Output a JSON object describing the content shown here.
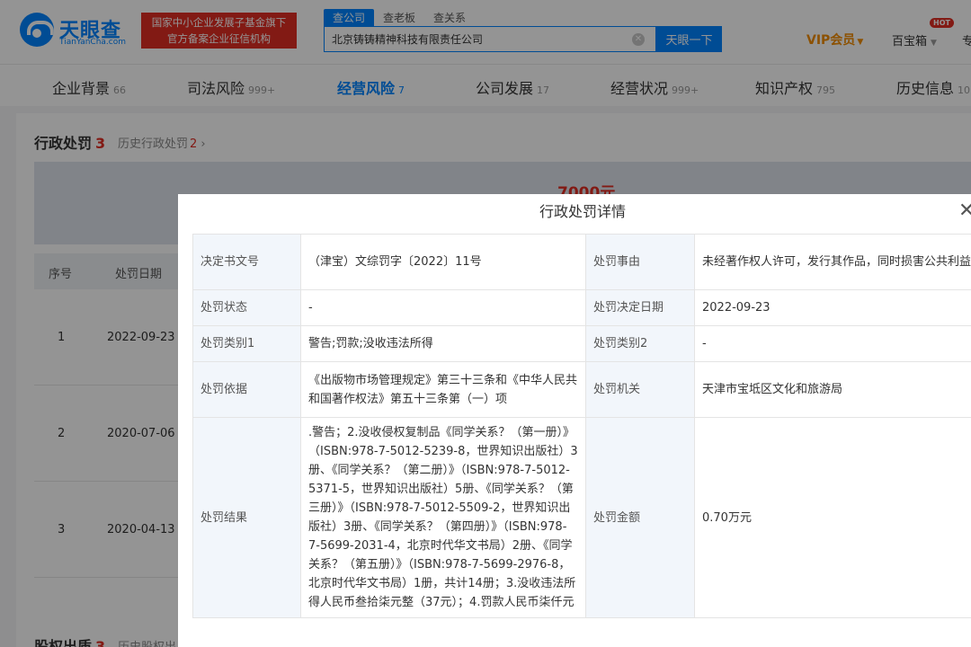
{
  "header": {
    "logo_text": "天眼查",
    "logo_sub": "TianYanCha.com",
    "banner_line1": "国家中小企业发展子基金旗下",
    "banner_line2": "官方备案企业征信机构",
    "search_tabs": [
      "查公司",
      "查老板",
      "查关系"
    ],
    "search_value": "北京铸铸精神科技有限责任公司",
    "search_button": "天眼一下",
    "vip_label": "VIP会员",
    "baibao_label": "百宝箱",
    "hot_badge": "HOT",
    "more_label": "专"
  },
  "nav": {
    "items": [
      {
        "label": "企业背景",
        "count": "66"
      },
      {
        "label": "司法风险",
        "count": "999+"
      },
      {
        "label": "经营风险",
        "count": "7"
      },
      {
        "label": "公司发展",
        "count": "17"
      },
      {
        "label": "经营状况",
        "count": "999+"
      },
      {
        "label": "知识产权",
        "count": "795"
      },
      {
        "label": "历史信息",
        "count": "10"
      }
    ]
  },
  "section": {
    "title": "行政处罚",
    "count": "3",
    "history_label": "历史行政处罚",
    "history_count": "2",
    "stat_value": "7000元",
    "table_headers": [
      "序号",
      "处罚日期"
    ],
    "rows": [
      {
        "index": "1",
        "date": "2022-09-23"
      },
      {
        "index": "2",
        "date": "2020-07-06"
      },
      {
        "index": "3",
        "date": "2020-04-13"
      }
    ],
    "next_title": "股权出质",
    "next_count": "3",
    "next_history": "历史股权出"
  },
  "modal": {
    "title": "行政处罚详情",
    "rows": [
      {
        "k1": "决定书文号",
        "v1": "（津宝）文综罚字〔2022〕11号",
        "k2": "处罚事由",
        "v2": "未经著作权人许可，发行其作品，同时损害公共利益"
      },
      {
        "k1": "处罚状态",
        "v1": "-",
        "k2": "处罚决定日期",
        "v2": "2022-09-23"
      },
      {
        "k1": "处罚类别1",
        "v1": "警告;罚款;没收违法所得",
        "k2": "处罚类别2",
        "v2": "-"
      },
      {
        "k1": "处罚依据",
        "v1": "《出版物市场管理规定》第三十三条和《中华人民共和国著作权法》第五十三条第（一）项",
        "k2": "处罚机关",
        "v2": "天津市宝坻区文化和旅游局"
      },
      {
        "k1": "处罚结果",
        "v1": ".警告；2.没收侵权复制品《同学关系？（第一册）》（ISBN:978-7-5012-5239-8，世界知识出版社）3册、《同学关系？（第二册）》（ISBN:978-7-5012-5371-5，世界知识出版社）5册、《同学关系？（第三册）》（ISBN:978-7-5012-5509-2，世界知识出版社）3册、《同学关系？（第四册）》（ISBN:978-7-5699-2031-4，北京时代华文书局）2册、《同学关系？（第五册）》（ISBN:978-7-5699-2976-8，北京时代华文书局）1册，共计14册；3.没收违法所得人民币叁拾柒元整（37元）；4.罚款人民币柒仟元",
        "k2": "处罚金额",
        "v2": "0.70万元"
      }
    ]
  }
}
